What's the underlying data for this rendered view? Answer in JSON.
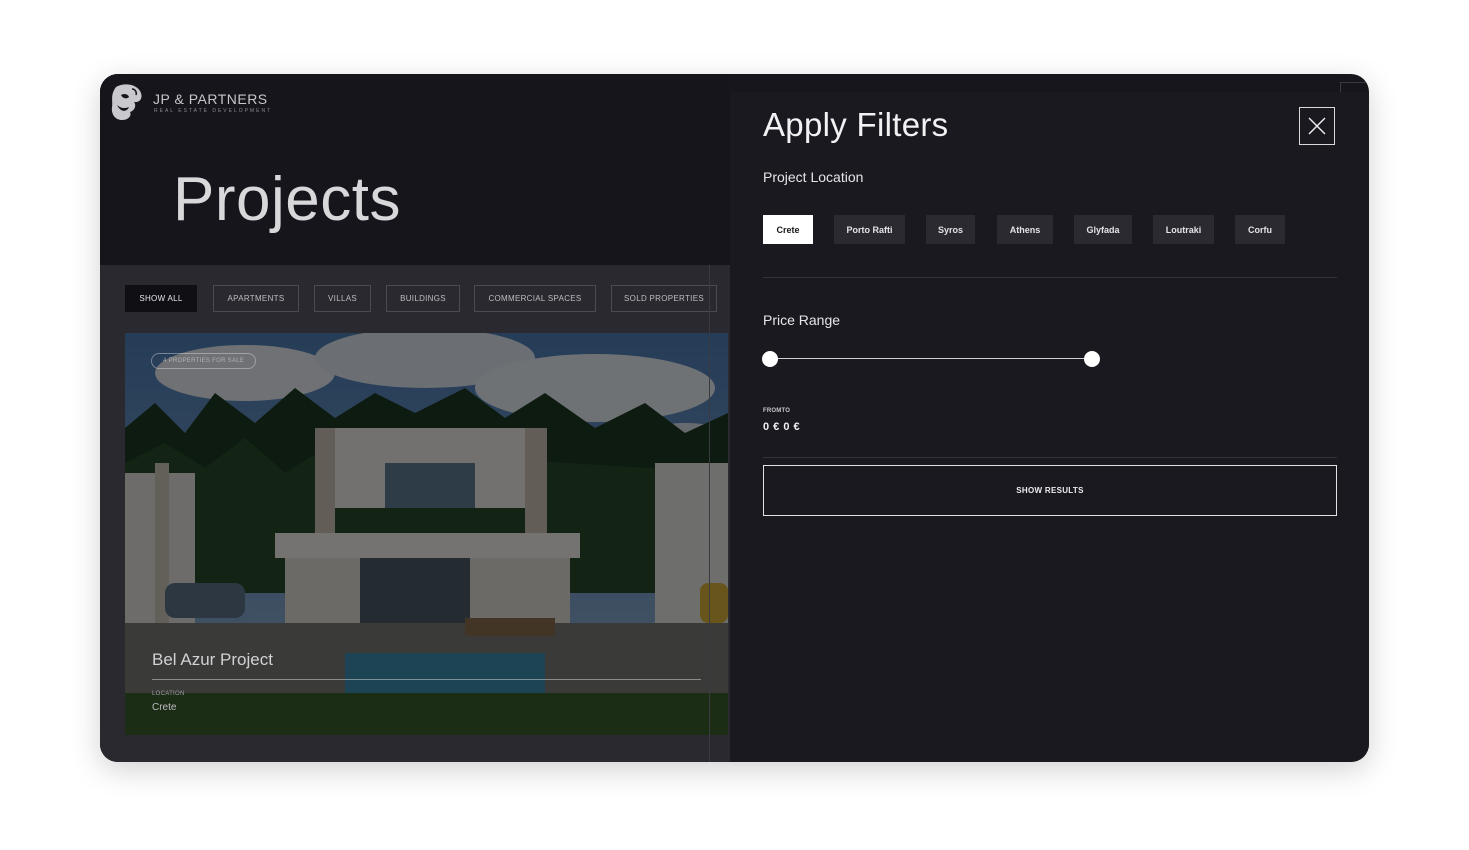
{
  "brand": {
    "name": "JP & PARTNERS",
    "tagline": "REAL ESTATE DEVELOPMENT",
    "logo_icon": "face-logo-icon"
  },
  "page": {
    "title": "Projects"
  },
  "categories": [
    {
      "label": "SHOW ALL",
      "active": true
    },
    {
      "label": "APARTMENTS",
      "active": false
    },
    {
      "label": "VILLAS",
      "active": false
    },
    {
      "label": "BUILDINGS",
      "active": false
    },
    {
      "label": "COMMERCIAL SPACES",
      "active": false
    },
    {
      "label": "SOLD PROPERTIES",
      "active": false
    }
  ],
  "project_card": {
    "badge": "4 PROPERTIES FOR SALE",
    "title": "Bel Azur Project",
    "location_label": "LOCATION",
    "location_value": "Crete"
  },
  "filters": {
    "title": "Apply Filters",
    "close_icon": "close-icon",
    "location_label": "Project Location",
    "locations": [
      {
        "label": "Crete",
        "active": true
      },
      {
        "label": "Porto Rafti",
        "active": false
      },
      {
        "label": "Syros",
        "active": false
      },
      {
        "label": "Athens",
        "active": false
      },
      {
        "label": "Glyfada",
        "active": false
      },
      {
        "label": "Loutraki",
        "active": false
      },
      {
        "label": "Corfu",
        "active": false
      }
    ],
    "price_label": "Price Range",
    "fromto_label": "FROMTO",
    "fromto_value": "0 € 0 €",
    "show_results": "SHOW RESULTS"
  },
  "colors": {
    "panel_bg": "#1a191f",
    "chip_bg": "#2b2a31",
    "active_chip_bg": "#ffffff"
  }
}
